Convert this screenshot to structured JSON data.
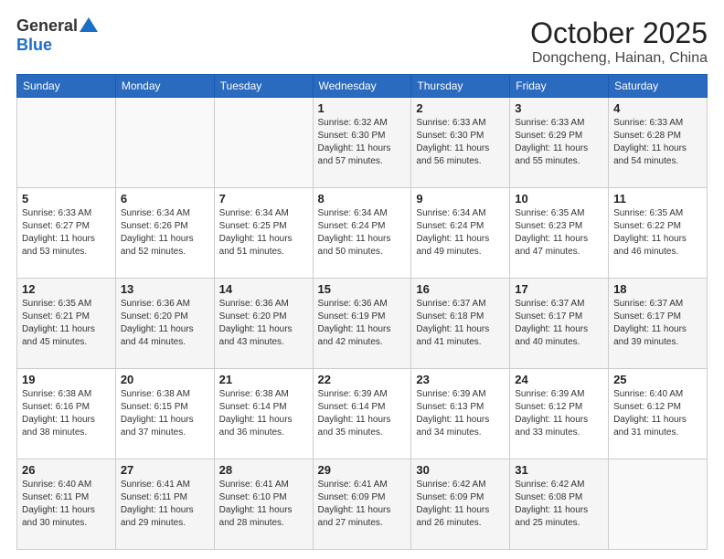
{
  "logo": {
    "general": "General",
    "blue": "Blue"
  },
  "header": {
    "month": "October 2025",
    "location": "Dongcheng, Hainan, China"
  },
  "weekdays": [
    "Sunday",
    "Monday",
    "Tuesday",
    "Wednesday",
    "Thursday",
    "Friday",
    "Saturday"
  ],
  "weeks": [
    [
      {
        "day": "",
        "sunrise": "",
        "sunset": "",
        "daylight": ""
      },
      {
        "day": "",
        "sunrise": "",
        "sunset": "",
        "daylight": ""
      },
      {
        "day": "",
        "sunrise": "",
        "sunset": "",
        "daylight": ""
      },
      {
        "day": "1",
        "sunrise": "Sunrise: 6:32 AM",
        "sunset": "Sunset: 6:30 PM",
        "daylight": "Daylight: 11 hours and 57 minutes."
      },
      {
        "day": "2",
        "sunrise": "Sunrise: 6:33 AM",
        "sunset": "Sunset: 6:30 PM",
        "daylight": "Daylight: 11 hours and 56 minutes."
      },
      {
        "day": "3",
        "sunrise": "Sunrise: 6:33 AM",
        "sunset": "Sunset: 6:29 PM",
        "daylight": "Daylight: 11 hours and 55 minutes."
      },
      {
        "day": "4",
        "sunrise": "Sunrise: 6:33 AM",
        "sunset": "Sunset: 6:28 PM",
        "daylight": "Daylight: 11 hours and 54 minutes."
      }
    ],
    [
      {
        "day": "5",
        "sunrise": "Sunrise: 6:33 AM",
        "sunset": "Sunset: 6:27 PM",
        "daylight": "Daylight: 11 hours and 53 minutes."
      },
      {
        "day": "6",
        "sunrise": "Sunrise: 6:34 AM",
        "sunset": "Sunset: 6:26 PM",
        "daylight": "Daylight: 11 hours and 52 minutes."
      },
      {
        "day": "7",
        "sunrise": "Sunrise: 6:34 AM",
        "sunset": "Sunset: 6:25 PM",
        "daylight": "Daylight: 11 hours and 51 minutes."
      },
      {
        "day": "8",
        "sunrise": "Sunrise: 6:34 AM",
        "sunset": "Sunset: 6:24 PM",
        "daylight": "Daylight: 11 hours and 50 minutes."
      },
      {
        "day": "9",
        "sunrise": "Sunrise: 6:34 AM",
        "sunset": "Sunset: 6:24 PM",
        "daylight": "Daylight: 11 hours and 49 minutes."
      },
      {
        "day": "10",
        "sunrise": "Sunrise: 6:35 AM",
        "sunset": "Sunset: 6:23 PM",
        "daylight": "Daylight: 11 hours and 47 minutes."
      },
      {
        "day": "11",
        "sunrise": "Sunrise: 6:35 AM",
        "sunset": "Sunset: 6:22 PM",
        "daylight": "Daylight: 11 hours and 46 minutes."
      }
    ],
    [
      {
        "day": "12",
        "sunrise": "Sunrise: 6:35 AM",
        "sunset": "Sunset: 6:21 PM",
        "daylight": "Daylight: 11 hours and 45 minutes."
      },
      {
        "day": "13",
        "sunrise": "Sunrise: 6:36 AM",
        "sunset": "Sunset: 6:20 PM",
        "daylight": "Daylight: 11 hours and 44 minutes."
      },
      {
        "day": "14",
        "sunrise": "Sunrise: 6:36 AM",
        "sunset": "Sunset: 6:20 PM",
        "daylight": "Daylight: 11 hours and 43 minutes."
      },
      {
        "day": "15",
        "sunrise": "Sunrise: 6:36 AM",
        "sunset": "Sunset: 6:19 PM",
        "daylight": "Daylight: 11 hours and 42 minutes."
      },
      {
        "day": "16",
        "sunrise": "Sunrise: 6:37 AM",
        "sunset": "Sunset: 6:18 PM",
        "daylight": "Daylight: 11 hours and 41 minutes."
      },
      {
        "day": "17",
        "sunrise": "Sunrise: 6:37 AM",
        "sunset": "Sunset: 6:17 PM",
        "daylight": "Daylight: 11 hours and 40 minutes."
      },
      {
        "day": "18",
        "sunrise": "Sunrise: 6:37 AM",
        "sunset": "Sunset: 6:17 PM",
        "daylight": "Daylight: 11 hours and 39 minutes."
      }
    ],
    [
      {
        "day": "19",
        "sunrise": "Sunrise: 6:38 AM",
        "sunset": "Sunset: 6:16 PM",
        "daylight": "Daylight: 11 hours and 38 minutes."
      },
      {
        "day": "20",
        "sunrise": "Sunrise: 6:38 AM",
        "sunset": "Sunset: 6:15 PM",
        "daylight": "Daylight: 11 hours and 37 minutes."
      },
      {
        "day": "21",
        "sunrise": "Sunrise: 6:38 AM",
        "sunset": "Sunset: 6:14 PM",
        "daylight": "Daylight: 11 hours and 36 minutes."
      },
      {
        "day": "22",
        "sunrise": "Sunrise: 6:39 AM",
        "sunset": "Sunset: 6:14 PM",
        "daylight": "Daylight: 11 hours and 35 minutes."
      },
      {
        "day": "23",
        "sunrise": "Sunrise: 6:39 AM",
        "sunset": "Sunset: 6:13 PM",
        "daylight": "Daylight: 11 hours and 34 minutes."
      },
      {
        "day": "24",
        "sunrise": "Sunrise: 6:39 AM",
        "sunset": "Sunset: 6:12 PM",
        "daylight": "Daylight: 11 hours and 33 minutes."
      },
      {
        "day": "25",
        "sunrise": "Sunrise: 6:40 AM",
        "sunset": "Sunset: 6:12 PM",
        "daylight": "Daylight: 11 hours and 31 minutes."
      }
    ],
    [
      {
        "day": "26",
        "sunrise": "Sunrise: 6:40 AM",
        "sunset": "Sunset: 6:11 PM",
        "daylight": "Daylight: 11 hours and 30 minutes."
      },
      {
        "day": "27",
        "sunrise": "Sunrise: 6:41 AM",
        "sunset": "Sunset: 6:11 PM",
        "daylight": "Daylight: 11 hours and 29 minutes."
      },
      {
        "day": "28",
        "sunrise": "Sunrise: 6:41 AM",
        "sunset": "Sunset: 6:10 PM",
        "daylight": "Daylight: 11 hours and 28 minutes."
      },
      {
        "day": "29",
        "sunrise": "Sunrise: 6:41 AM",
        "sunset": "Sunset: 6:09 PM",
        "daylight": "Daylight: 11 hours and 27 minutes."
      },
      {
        "day": "30",
        "sunrise": "Sunrise: 6:42 AM",
        "sunset": "Sunset: 6:09 PM",
        "daylight": "Daylight: 11 hours and 26 minutes."
      },
      {
        "day": "31",
        "sunrise": "Sunrise: 6:42 AM",
        "sunset": "Sunset: 6:08 PM",
        "daylight": "Daylight: 11 hours and 25 minutes."
      },
      {
        "day": "",
        "sunrise": "",
        "sunset": "",
        "daylight": ""
      }
    ]
  ]
}
